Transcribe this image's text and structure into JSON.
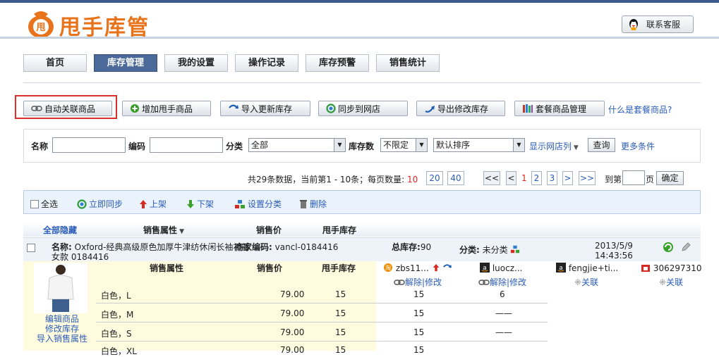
{
  "header": {
    "brand": "甩手库管",
    "contact_label": "联系客服"
  },
  "nav": {
    "tabs": [
      {
        "label": "首页",
        "active": false
      },
      {
        "label": "库存管理",
        "active": true
      },
      {
        "label": "我的设置",
        "active": false
      },
      {
        "label": "操作记录",
        "active": false
      },
      {
        "label": "库存预警",
        "active": false
      },
      {
        "label": "销售统计",
        "active": false
      }
    ]
  },
  "toolbar": {
    "auto_link": "自动关联商品",
    "add_item": "增加甩手商品",
    "import_update": "导入更新库存",
    "sync_shop": "同步到网店",
    "export_modify": "导出修改库存",
    "bundle_manage": "套餐商品管理",
    "bundle_help": "什么是套餐商品?"
  },
  "filter": {
    "name_label": "名称",
    "code_label": "编码",
    "category_label": "分类",
    "category_value": "全部",
    "stock_label": "库存数",
    "stock_value": "不限定",
    "sort_value": "默认排序",
    "show_shop_cols": "显示网店列",
    "search_button": "查询",
    "more_conditions": "更多条件"
  },
  "pager": {
    "summary_prefix": "共29条数据，当前第1 - 10条；每页数量:",
    "page_size_current": "10",
    "page_size_options": [
      "20",
      "40"
    ],
    "first": "<<",
    "prev": "<",
    "pages": [
      "1",
      "2",
      "3"
    ],
    "next": ">",
    "last": ">>",
    "goto_prefix": "到第",
    "goto_suffix": "页",
    "confirm": "确定"
  },
  "actions": {
    "select_all": "全选",
    "sync_now": "立即同步",
    "list": "上架",
    "delist": "下架",
    "set_category": "设置分类",
    "delete": "删除"
  },
  "table_header": {
    "hide_all": "全部隐藏",
    "sale_attr": "销售属性",
    "price": "销售价",
    "stock": "甩手库存"
  },
  "product": {
    "name_label": "名称:",
    "name_value": "Oxford-经典高级原色加厚牛津纺休闲长袖衬衫",
    "name_cont": "女款 0184416",
    "merchant_code_label": "商家编码:",
    "merchant_code_value": "vancl-0184416",
    "total_stock_label": "总库存:",
    "total_stock_value": "90",
    "category_label": "分类:",
    "category_value": "未分类",
    "date": "2013/5/9",
    "time": "14:43:56",
    "side_links": [
      "编辑商品",
      "修改库存",
      "导入销售属性"
    ],
    "sub_header": {
      "sale_attr": "销售属性",
      "price": "销售价",
      "stock": "甩手库存"
    },
    "shops": [
      {
        "name": "zbs11...",
        "actions": "解除|修改"
      },
      {
        "name": "luocz...",
        "actions": "解除|修改"
      },
      {
        "name": "fengjie+ti...",
        "actions": "关联"
      },
      {
        "name": "306297310",
        "actions": "关联"
      }
    ],
    "skus": [
      {
        "attr": "白色，L",
        "price": "79.00",
        "stock": "15",
        "shop1": "15",
        "shop2": "6"
      },
      {
        "attr": "白色，M",
        "price": "79.00",
        "stock": "15",
        "shop1": "15",
        "shop2": "——"
      },
      {
        "attr": "白色，S",
        "price": "79.00",
        "stock": "15",
        "shop1": "15",
        "shop2": "——"
      },
      {
        "attr": "白色，XL",
        "price": "79.00",
        "stock": "15",
        "shop1": "15",
        "shop2": ""
      }
    ]
  }
}
